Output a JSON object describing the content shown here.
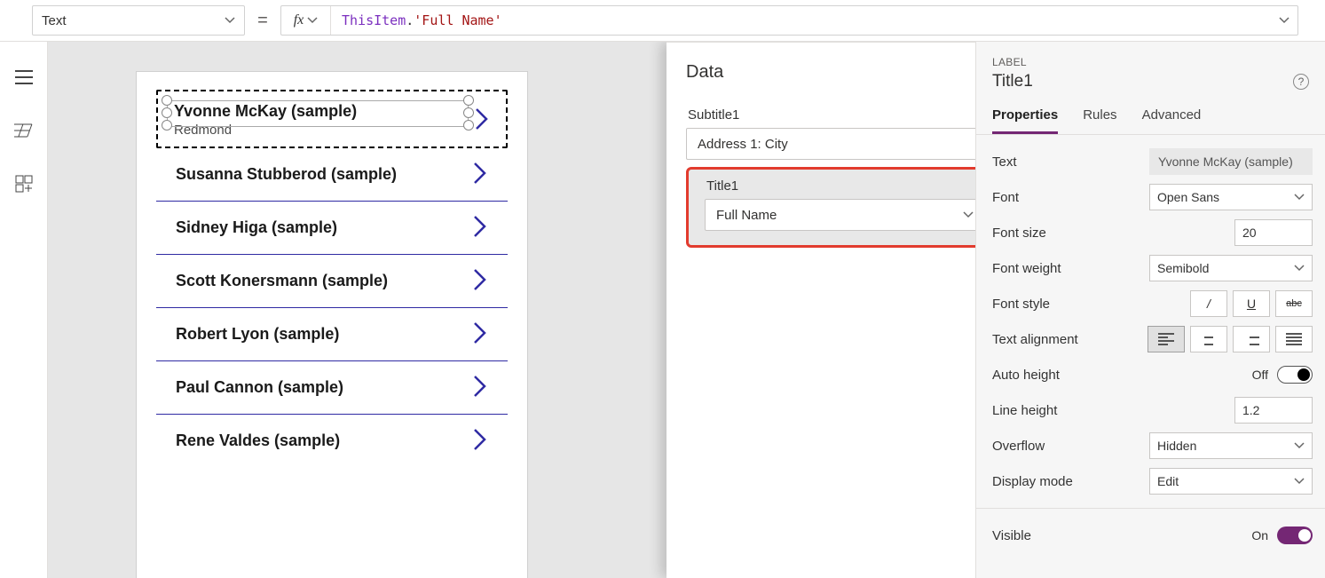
{
  "formulaBar": {
    "property": "Text",
    "tokenThis": "ThisItem",
    "tokenDot": ".",
    "tokenStr": "'Full Name'"
  },
  "gallery": {
    "items": [
      {
        "title": "Yvonne McKay (sample)",
        "subtitle": "Redmond"
      },
      {
        "title": "Susanna Stubberod (sample)"
      },
      {
        "title": "Sidney Higa (sample)"
      },
      {
        "title": "Scott Konersmann (sample)"
      },
      {
        "title": "Robert Lyon (sample)"
      },
      {
        "title": "Paul Cannon (sample)"
      },
      {
        "title": "Rene Valdes (sample)"
      }
    ]
  },
  "dataPanel": {
    "title": "Data",
    "subtitleField": {
      "label": "Subtitle1",
      "value": "Address 1: City"
    },
    "titleField": {
      "label": "Title1",
      "value": "Full Name"
    }
  },
  "props": {
    "typeLabel": "LABEL",
    "controlName": "Title1",
    "tabs": {
      "properties": "Properties",
      "rules": "Rules",
      "advanced": "Advanced"
    },
    "rows": {
      "text": {
        "label": "Text",
        "value": "Yvonne McKay (sample)"
      },
      "font": {
        "label": "Font",
        "value": "Open Sans"
      },
      "fontSize": {
        "label": "Font size",
        "value": "20"
      },
      "fontWeight": {
        "label": "Font weight",
        "value": "Semibold"
      },
      "fontStyle": {
        "label": "Font style"
      },
      "textAlign": {
        "label": "Text alignment"
      },
      "autoHeight": {
        "label": "Auto height",
        "state": "Off"
      },
      "lineHeight": {
        "label": "Line height",
        "value": "1.2"
      },
      "overflow": {
        "label": "Overflow",
        "value": "Hidden"
      },
      "displayMode": {
        "label": "Display mode",
        "value": "Edit"
      },
      "visible": {
        "label": "Visible",
        "state": "On"
      }
    },
    "styleButtons": {
      "italic": "/",
      "underline": "U",
      "strike": "abc"
    }
  }
}
